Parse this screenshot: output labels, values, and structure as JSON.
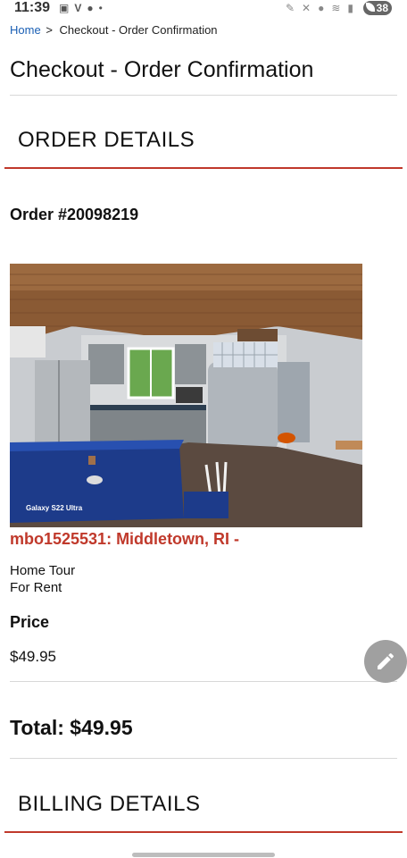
{
  "status_bar": {
    "time": "11:39",
    "left_icons": [
      "video-icon",
      "v-icon",
      "message-icon",
      "dot-icon"
    ],
    "right_icons": [
      "pencil-icon",
      "mute-icon",
      "location-icon",
      "wifi-icon",
      "signal-icon"
    ],
    "battery": "38"
  },
  "breadcrumb": {
    "home": "Home",
    "separator": ">",
    "current": "Checkout - Order Confirmation"
  },
  "page_title": "Checkout - Order Confirmation",
  "order_details": {
    "heading": "ORDER DETAILS",
    "order_number": "Order #20098219",
    "image_watermark": "Galaxy S22 Ultra",
    "product_title": "mbo1525531: Middletown, RI -",
    "product_lines": [
      "Home Tour",
      "For Rent"
    ],
    "price_label": "Price",
    "price_value": "$49.95",
    "total": "Total: $49.95"
  },
  "billing_details": {
    "heading": "BILLING DETAILS"
  },
  "colors": {
    "accent_red": "#c0392b",
    "link_blue": "#1a5fb4",
    "fab_gray": "#a0a0a0"
  }
}
